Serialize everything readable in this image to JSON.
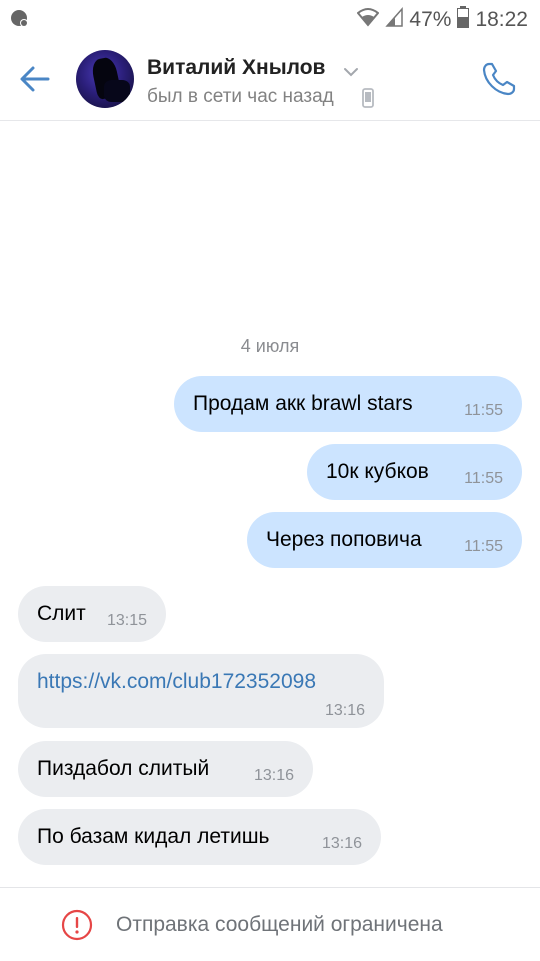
{
  "status_bar": {
    "battery": "47%",
    "time": "18:22"
  },
  "header": {
    "contact_name": "Виталий Хнылов",
    "last_seen": "был в сети час назад"
  },
  "chat": {
    "date_separator": "4 июля",
    "messages": [
      {
        "direction": "out",
        "text": "Продам акк brawl stars",
        "time": "11:55"
      },
      {
        "direction": "out",
        "text": "10к кубков",
        "time": "11:55"
      },
      {
        "direction": "out",
        "text": "Через поповича",
        "time": "11:55"
      },
      {
        "direction": "in",
        "text": "Слит",
        "time": "13:15"
      },
      {
        "direction": "in",
        "text": "https://vk.com/club172352098",
        "time": "13:16",
        "is_link": true
      },
      {
        "direction": "in",
        "text": "Пиздабол слитый",
        "time": "13:16"
      },
      {
        "direction": "in",
        "text": "По базам кидал летишь",
        "time": "13:16"
      }
    ]
  },
  "footer": {
    "notice": "Отправка сообщений ограничена"
  },
  "colors": {
    "accent": "#4a86c5",
    "outgoing_bubble": "#cce4ff",
    "incoming_bubble": "#ebedf0",
    "warning": "#e64646"
  }
}
